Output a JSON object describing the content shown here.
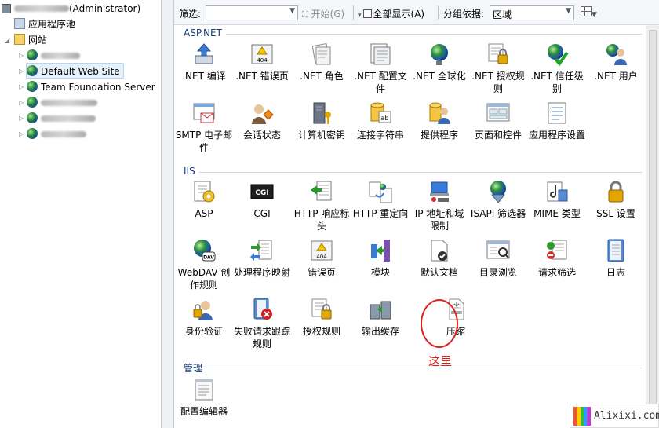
{
  "tree": {
    "root_label": "(Administrator)",
    "app_pools": "应用程序池",
    "sites": "网站",
    "site_items": [
      "Default Web Site",
      "Team Foundation Server"
    ]
  },
  "toolbar": {
    "filter_label": "筛选:",
    "start_label": "开始(G)",
    "show_all_label": "全部显示(A)",
    "group_by_label": "分组依据:",
    "group_by_value": "区域"
  },
  "groups": {
    "aspnet": "ASP.NET",
    "iis": "IIS",
    "management": "管理"
  },
  "tiles": {
    "aspnet": [
      ".NET 编译",
      ".NET 错误页",
      ".NET 角色",
      ".NET 配置文件",
      ".NET 全球化",
      ".NET 授权规则",
      ".NET 信任级别",
      ".NET 用户",
      "SMTP 电子邮件",
      "会话状态",
      "计算机密钥",
      "连接字符串",
      "提供程序",
      "页面和控件",
      "应用程序设置"
    ],
    "iis": [
      "ASP",
      "CGI",
      "HTTP 响应标头",
      "HTTP 重定向",
      "IP 地址和域限制",
      "ISAPI 筛选器",
      "MIME 类型",
      "SSL 设置",
      "WebDAV 创作规则",
      "处理程序映射",
      "错误页",
      "模块",
      "默认文档",
      "目录浏览",
      "请求筛选",
      "日志",
      "身份验证",
      "失败请求跟踪规则",
      "授权规则",
      "输出缓存",
      "压缩"
    ],
    "management": [
      "配置编辑器"
    ]
  },
  "icon_texts": {
    "error_page": "404",
    "cgi": "CGI",
    "webdav": "DAV"
  },
  "annotation": "这里",
  "watermark": "Alixixi.com",
  "colors": {
    "annotation": "#e02020",
    "group_header": "#1b3f7a"
  }
}
